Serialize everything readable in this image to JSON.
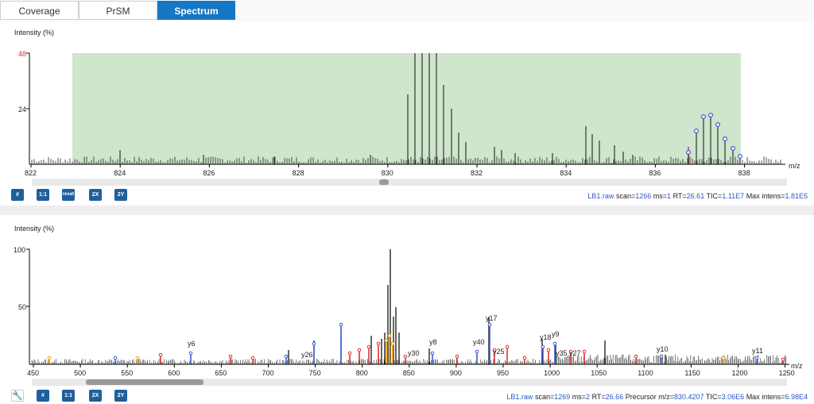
{
  "tabs": [
    {
      "label": "Coverage",
      "active": false
    },
    {
      "label": "PrSM",
      "active": false
    },
    {
      "label": "Spectrum",
      "active": true
    }
  ],
  "ms1": {
    "y_axis_label": "Intensity (%)",
    "x_unit": "m/z",
    "y_ticks": [
      "48",
      "24"
    ],
    "x_ticks": [
      "822",
      "824",
      "826",
      "828",
      "830",
      "832",
      "834",
      "836",
      "838"
    ],
    "buttons": [
      "#",
      "1:1",
      "reset",
      "2X",
      "2Y"
    ],
    "info": {
      "file": "LB1.raw",
      "scan_label": "scan=",
      "scan": "1266",
      "ms_label": "ms=",
      "ms": "1",
      "rt_label": "RT=",
      "rt": "26.61",
      "tic_label": "TIC=",
      "tic": "1.11E7",
      "max_label": "Max intens=",
      "max": "1.81E5"
    }
  },
  "ms2": {
    "y_axis_label": "Intensity (%)",
    "x_unit": "m/z",
    "y_ticks": [
      "100",
      "50"
    ],
    "x_ticks": [
      "450",
      "500",
      "550",
      "600",
      "650",
      "700",
      "750",
      "800",
      "850",
      "900",
      "950",
      "1000",
      "1050",
      "1100",
      "1150",
      "1200",
      "1250"
    ],
    "ion_labels": [
      "y6",
      "y26",
      "y30",
      "y8",
      "y40",
      "y17",
      "y25",
      "y18",
      "y9",
      "y35",
      "y27",
      "y10",
      "y11"
    ],
    "buttons": [
      "#",
      "1:1",
      "2X",
      "2Y"
    ],
    "info": {
      "file": "LB1.raw",
      "scan_label": "scan=",
      "scan": "1269",
      "ms_label": "ms=",
      "ms": "2",
      "rt_label": "RT=",
      "rt": "26.66",
      "prec_label": "Precursor m/z=",
      "prec": "830.4207",
      "tic_label": "TIC=",
      "tic": "3.06E6",
      "max_label": "Max intens=",
      "max": "6.98E4"
    }
  },
  "colors": {
    "accent": "#1677c4",
    "highlight": "#cfe5cc",
    "envelope": "#3a5bd9",
    "red_peak": "#e03131",
    "orange_peak": "#f59f00"
  }
}
